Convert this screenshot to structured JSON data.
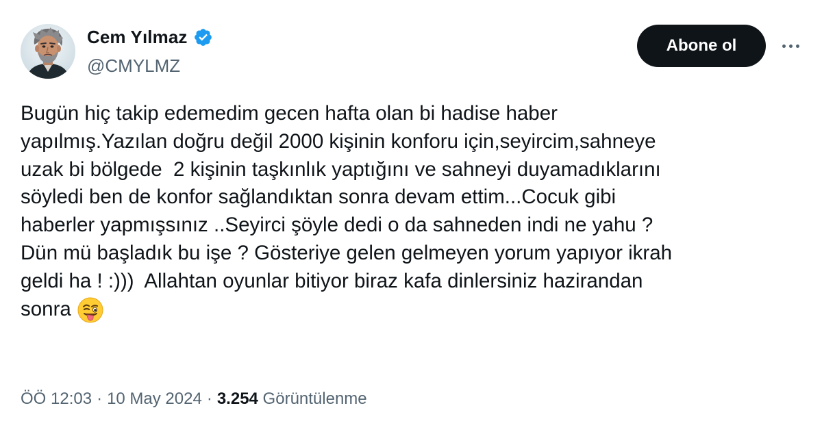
{
  "author": {
    "display_name": "Cem Yılmaz",
    "handle": "@CMYLMZ",
    "verified_color": "#1d9bf0"
  },
  "actions": {
    "follow_label": "Abone ol",
    "more_icon": "more-horizontal-icon"
  },
  "tweet": {
    "lines": [
      "Bugün hiç takip edemedim gecen hafta olan bi hadise haber",
      "yapılmış.Yazılan doğru değil 2000 kişinin konforu için,seyircim,sahneye",
      "uzak bi bölgede  2 kişinin taşkınlık yaptığını ve sahneyi duyamadıklarını",
      "söyledi ben de konfor sağlandıktan sonra devam ettim...Cocuk gibi",
      "haberler yapmışsınız ..Seyirci şöyle dedi o da sahneden indi ne yahu ?",
      "Dün mü başladık bu işe ? Gösteriye gelen gelmeyen yorum yapıyor ikrah",
      "geldi ha ! :)))  Allahtan oyunlar bitiyor biraz kafa dinlersiniz hazirandan",
      "sonra"
    ],
    "emoji": "winking-face-with-tongue-icon"
  },
  "meta": {
    "time": "ÖÖ 12:03",
    "separator": "·",
    "date": "10 May 2024",
    "views_count": "3.254",
    "views_label": " Görüntülenme"
  },
  "colors": {
    "text_primary": "#0f1419",
    "text_secondary": "#536471",
    "button_bg": "#0f1419",
    "accent": "#1d9bf0"
  }
}
